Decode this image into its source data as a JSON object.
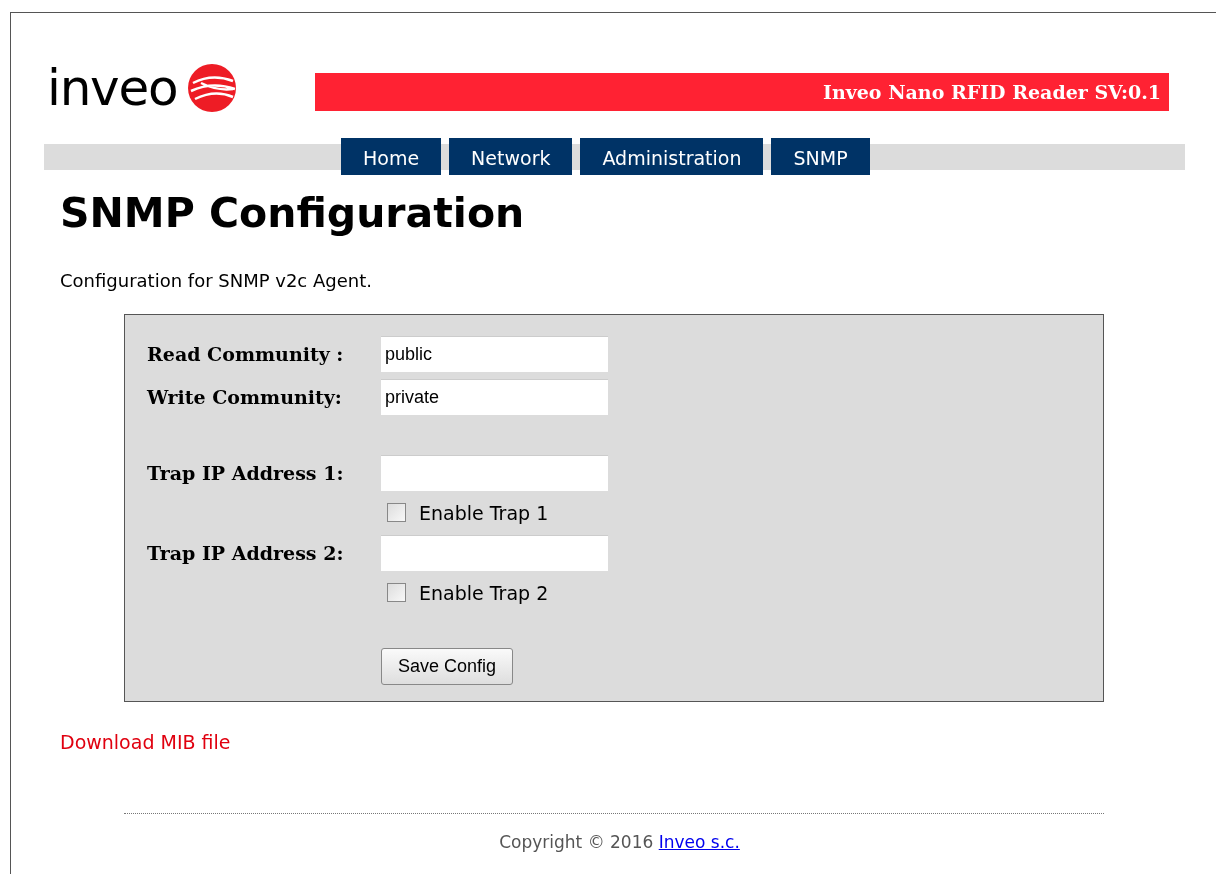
{
  "logo": {
    "text": "inveo"
  },
  "banner": {
    "title": "Inveo Nano RFID Reader SV:0.1"
  },
  "tabs": [
    {
      "label": "Home"
    },
    {
      "label": "Network"
    },
    {
      "label": "Administration"
    },
    {
      "label": "SNMP"
    }
  ],
  "heading": "SNMP Configuration",
  "description": "Configuration for SNMP v2c Agent.",
  "form": {
    "fields": [
      {
        "kind": "text",
        "label": "Read Community :",
        "value": "public"
      },
      {
        "kind": "text",
        "label": "Write Community:",
        "value": "private"
      },
      {
        "kind": "spacer"
      },
      {
        "kind": "text",
        "label": "Trap IP Address 1:"
      },
      {
        "kind": "checkbox",
        "label": "Enable Trap 1",
        "checked": false
      },
      {
        "kind": "text",
        "label": "Trap IP Address 2:"
      },
      {
        "kind": "checkbox",
        "label": "Enable Trap 2",
        "checked": false
      },
      {
        "kind": "spacer"
      },
      {
        "kind": "button",
        "label": "Save Config"
      }
    ]
  },
  "download_link": "Download MIB file",
  "footer": {
    "text": "Copyright © 2016",
    "link": "Inveo s.c."
  }
}
